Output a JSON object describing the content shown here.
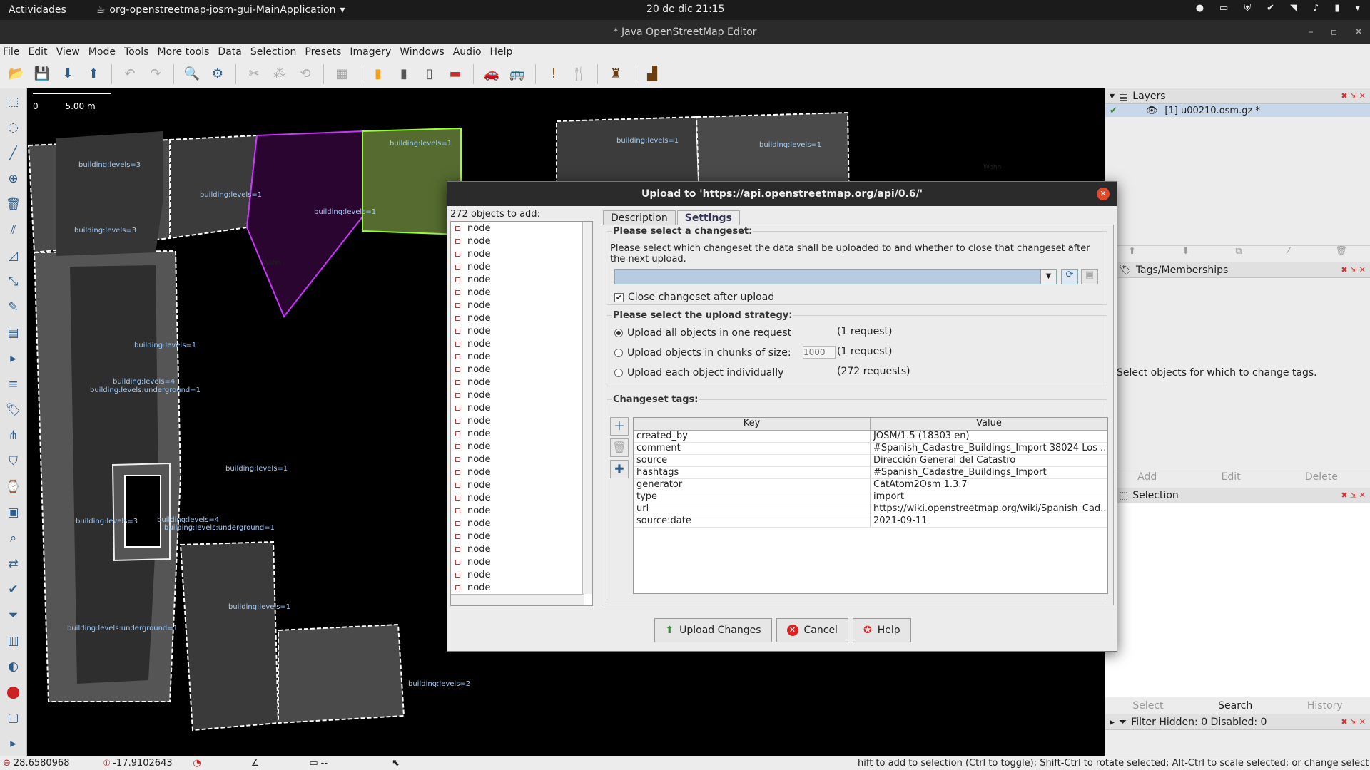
{
  "topbar": {
    "activities": "Actividades",
    "app_name": "org-openstreetmap-josm-gui-MainApplication",
    "clock": "20 de dic  21:15"
  },
  "window": {
    "title": "* Java OpenStreetMap Editor"
  },
  "menu": [
    "File",
    "Edit",
    "View",
    "Mode",
    "Tools",
    "More tools",
    "Data",
    "Selection",
    "Presets",
    "Imagery",
    "Windows",
    "Audio",
    "Help"
  ],
  "map": {
    "scale_label": "5.00 m",
    "scale_zero": "0",
    "labels": [
      "building:levels=3",
      "building:levels=1",
      "building:levels=3",
      "building:levels=1",
      "building:levels=1",
      "building:levels=1",
      "building:levels=1",
      "building:levels=1",
      "building:levels=4",
      "building:levels:underground=1",
      "building:levels=3",
      "building:levels=4",
      "building:levels:underground=1",
      "building:levels=1",
      "building:levels=1",
      "building:levels:underground=1",
      "building:levels=2"
    ],
    "wohn": "Wohn"
  },
  "panels": {
    "layers": {
      "title": "Layers",
      "layer_item": "[1] u00210.osm.gz *"
    },
    "tags": {
      "title": "Tags/Memberships",
      "empty_msg": "Select objects for which to change tags.",
      "add": "Add",
      "edit": "Edit",
      "delete": "Delete"
    },
    "selection": {
      "title": "Selection",
      "select": "Select",
      "search": "Search",
      "history": "History"
    },
    "filter": {
      "text": "Filter Hidden: 0 Disabled: 0"
    }
  },
  "status": {
    "lat": "28.6580968",
    "lon": "-17.9102643",
    "dist": "--",
    "help": "hift to add to selection (Ctrl to toggle); Shift-Ctrl to rotate selected; Alt-Ctrl to scale selected; or change selection"
  },
  "dialog": {
    "title": "Upload to 'https://api.openstreetmap.org/api/0.6/'",
    "objects_header": "272 objects to add:",
    "object_label": "node",
    "tabs": [
      "Description",
      "Settings"
    ],
    "changeset_group": "Please select a changeset:",
    "changeset_desc": "Please select which changeset the data shall be uploaded to and whether to close that changeset after the next upload.",
    "close_changeset": "Close changeset after upload",
    "strategy_group": "Please select the upload strategy:",
    "strategies": [
      {
        "label": "Upload all objects in one request",
        "note": "(1 request)",
        "selected": true
      },
      {
        "label": "Upload objects in chunks of size:",
        "note": "(1 request)",
        "selected": false,
        "chunk": "1000"
      },
      {
        "label": "Upload each object individually",
        "note": "(272 requests)",
        "selected": false
      }
    ],
    "tags_group": "Changeset tags:",
    "tag_headers": {
      "key": "Key",
      "value": "Value"
    },
    "tags": [
      {
        "key": "created_by",
        "value": "JOSM/1.5 (18303 en)"
      },
      {
        "key": "comment",
        "value": "#Spanish_Cadastre_Buildings_Import 38024 Los ..."
      },
      {
        "key": "source",
        "value": "Dirección General del Catastro"
      },
      {
        "key": "hashtags",
        "value": "#Spanish_Cadastre_Buildings_Import"
      },
      {
        "key": "generator",
        "value": "CatAtom2Osm 1.3.7"
      },
      {
        "key": "type",
        "value": "import"
      },
      {
        "key": "url",
        "value": "https://wiki.openstreetmap.org/wiki/Spanish_Cad..."
      },
      {
        "key": "source:date",
        "value": "2021-09-11"
      }
    ],
    "buttons": {
      "upload": "Upload Changes",
      "cancel": "Cancel",
      "help": "Help"
    }
  }
}
